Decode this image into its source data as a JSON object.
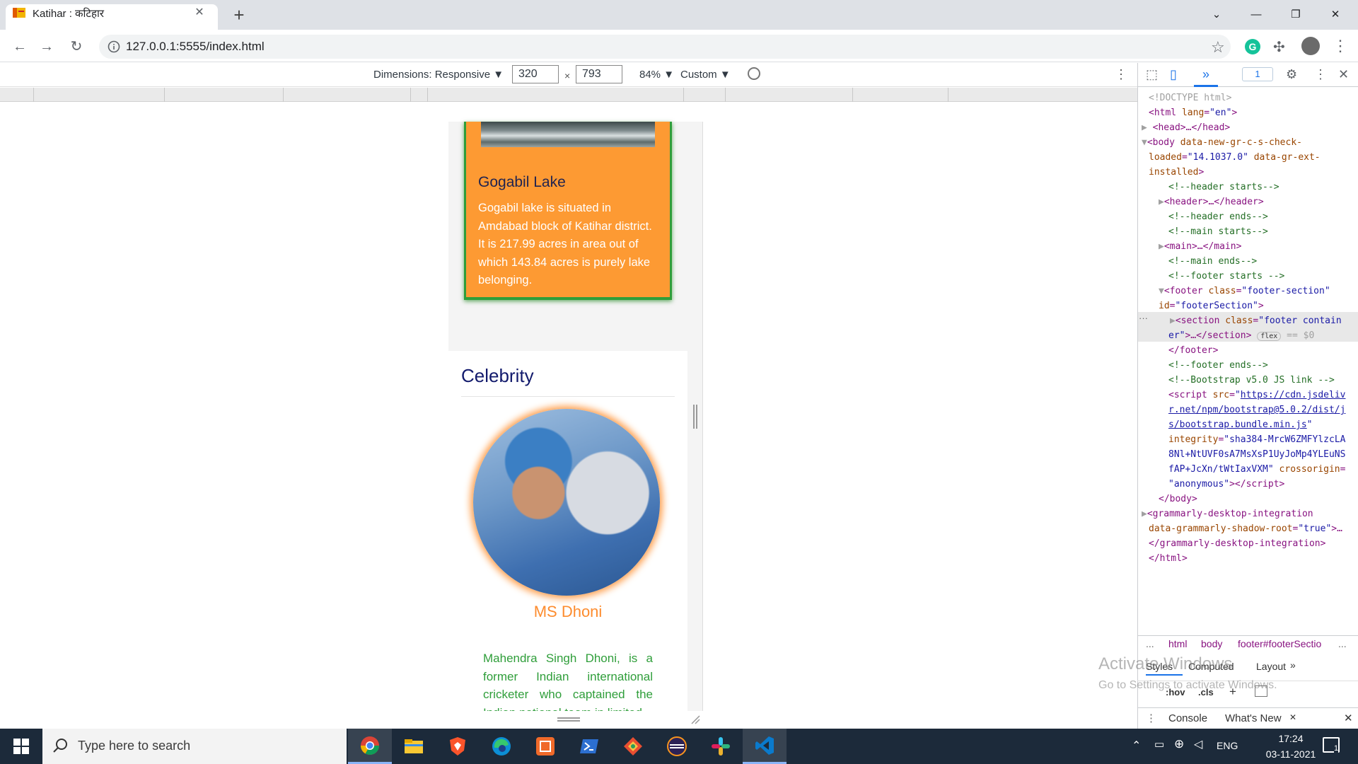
{
  "browser": {
    "tab_title": "Katihar : कटिहार",
    "tab_close": "✕",
    "new_tab": "+",
    "url": "127.0.0.1:5555/index.html",
    "window_controls": {
      "dropdown": "⌄",
      "minimize": "—",
      "maximize": "❐",
      "close": "✕"
    },
    "nav": {
      "back": "←",
      "forward": "→",
      "reload": "↻"
    }
  },
  "device_toolbar": {
    "dimensions_label": "Dimensions: Responsive ▼",
    "width": "320",
    "times": "×",
    "height": "793",
    "zoom": "84% ▼",
    "throttle": "Custom ▼"
  },
  "page": {
    "lake": {
      "title": "Gogabil Lake",
      "description": "Gogabil lake is situated in Amdabad block of Katihar district. It is 217.99 acres in area out of which 143.84 acres is purely lake belonging."
    },
    "celebrity": {
      "heading": "Celebrity",
      "name": "MS Dhoni",
      "description": "Mahendra Singh Dhoni, is a former Indian international cricketer who captained the Indian national team in limited"
    }
  },
  "devtools": {
    "badge": "1",
    "lines": [
      "<!DOCTYPE html>"
    ],
    "breadcrumbs": [
      "...",
      "html",
      "body",
      "footer#footerSectio",
      "..."
    ],
    "styles_tabs": [
      "Styles",
      "Computed",
      "Layout",
      "»"
    ],
    "filter_hov": ":hov",
    "filter_cls": ".cls",
    "filter_plus": "+",
    "drawer_tabs": [
      "Console",
      "What's New"
    ],
    "drawer_close": "✕",
    "watermark_line1": "Activate Windows",
    "watermark_line2": "Go to Settings to activate Windows."
  },
  "taskbar": {
    "search_placeholder": "Type here to search",
    "time": "17:24",
    "date": "03-11-2021",
    "language": "ENG",
    "notifications": "1"
  },
  "colors": {
    "lake_card": "#fd9a33",
    "card_border": "#2f9e3a",
    "celeb_heading": "#121a6c",
    "celeb_name": "#fd8c2e",
    "celeb_text": "#2f9e3a"
  }
}
